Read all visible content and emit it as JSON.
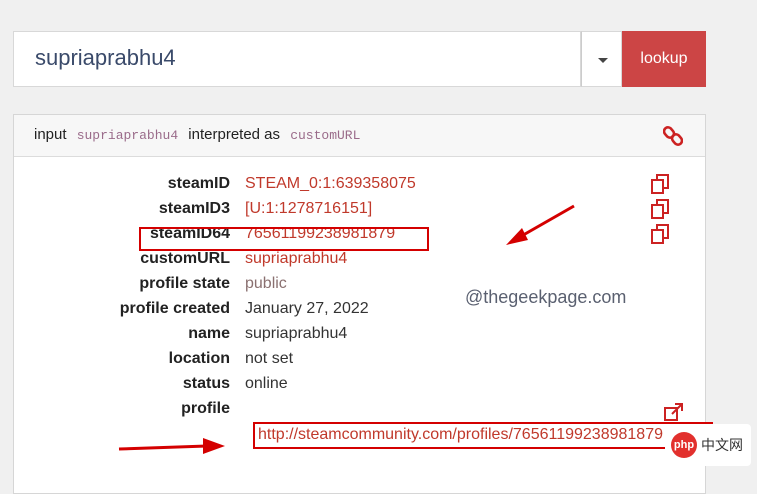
{
  "search": {
    "value": "supriaprabhu4",
    "lookup_label": "lookup"
  },
  "panel": {
    "head_prefix": "input",
    "input_value": "supriaprabhu4",
    "interpreted_text": "interpreted as",
    "interpreted_type": "customURL"
  },
  "rows": [
    {
      "label": "steamID",
      "value": "STEAM_0:1:639358075",
      "style": "red",
      "copy": true
    },
    {
      "label": "steamID3",
      "value": "[U:1:1278716151]",
      "style": "red",
      "copy": true
    },
    {
      "label": "steamID64",
      "value": "76561199238981879",
      "style": "red",
      "copy": true
    },
    {
      "label": "customURL",
      "value": "supriaprabhu4",
      "style": "red",
      "copy": false
    },
    {
      "label": "profile state",
      "value": "public",
      "style": "gray",
      "copy": false
    },
    {
      "label": "profile created",
      "value": "January 27, 2022",
      "style": "plain",
      "copy": false
    },
    {
      "label": "name",
      "value": "supriaprabhu4",
      "style": "plain",
      "copy": false
    },
    {
      "label": "location",
      "value": "not set",
      "style": "plain",
      "copy": false
    },
    {
      "label": "status",
      "value": "online",
      "style": "plain",
      "copy": false
    },
    {
      "label": "profile",
      "value": "",
      "style": "plain",
      "copy": false
    }
  ],
  "profile_url": "http://steamcommunity.com/profiles/76561199238981879",
  "watermark": "@thegeekpage.com",
  "badge": {
    "logo": "php",
    "text": "中文网"
  },
  "colors": {
    "accent": "#cc4545",
    "link": "#c0392b",
    "highlight": "#d40000"
  }
}
